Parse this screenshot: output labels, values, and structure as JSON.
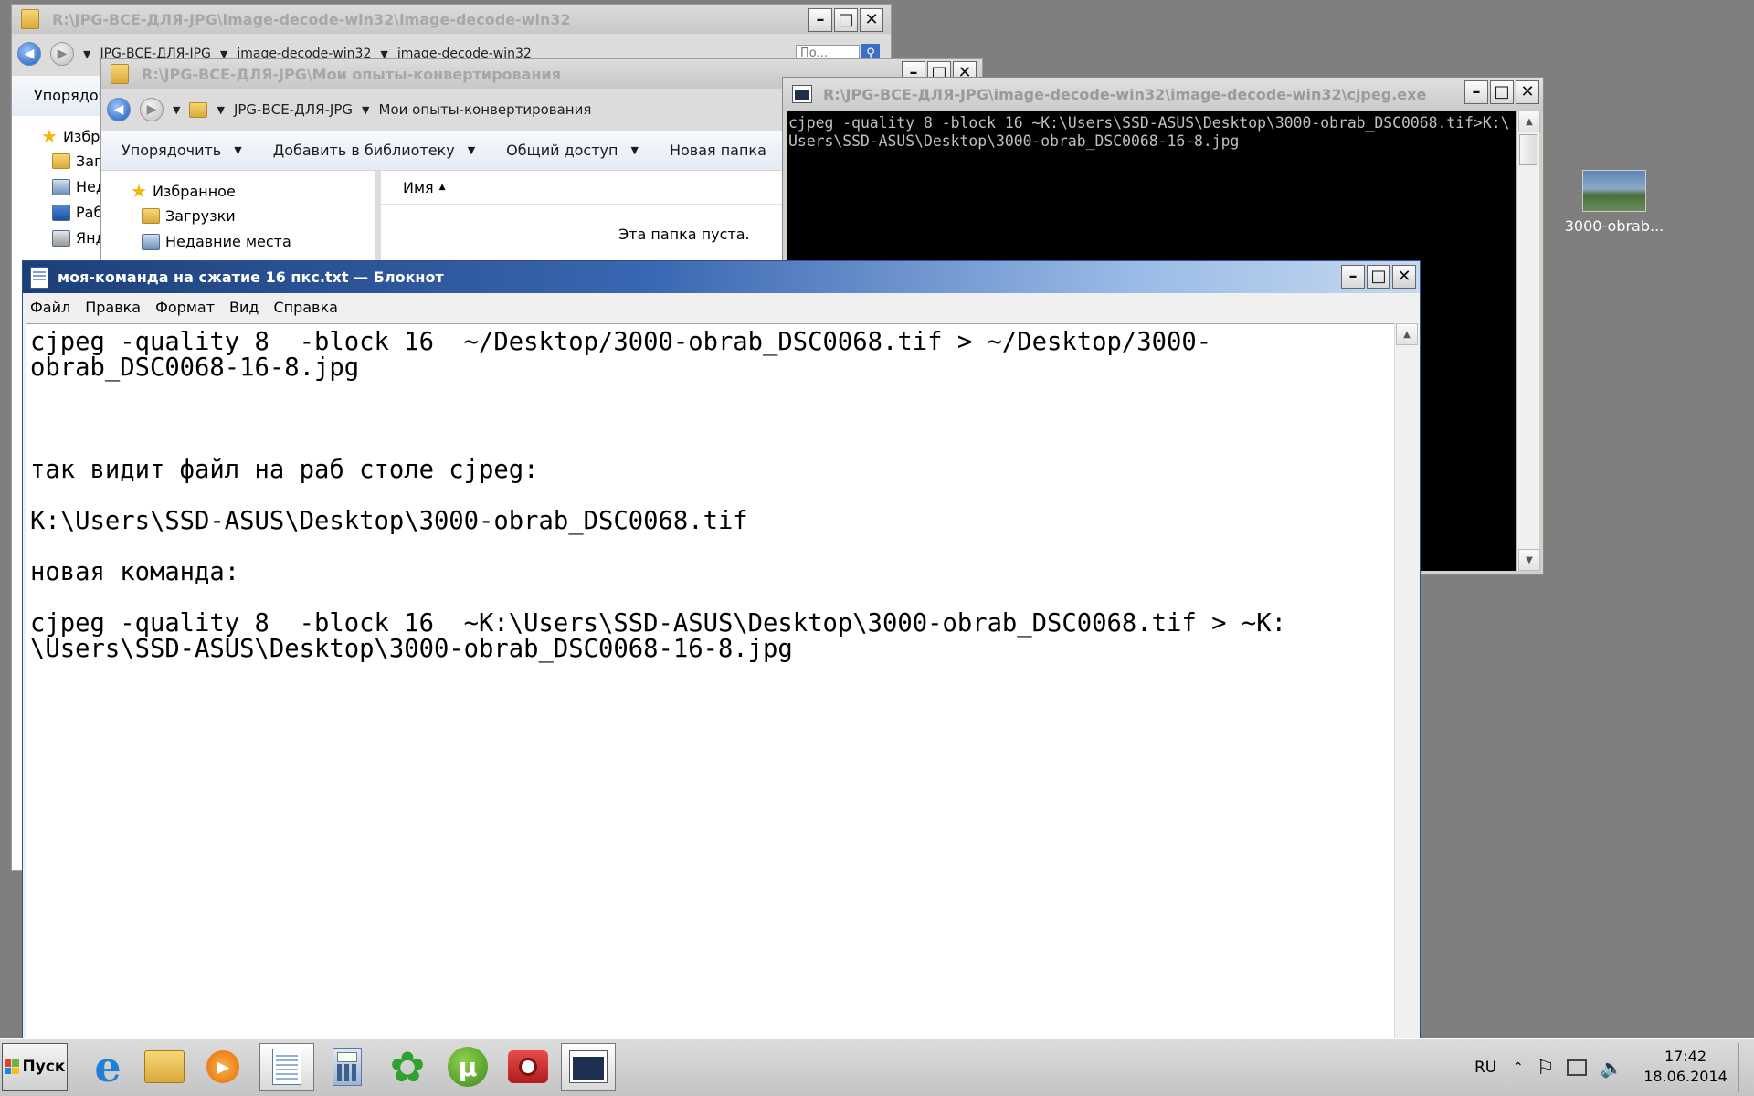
{
  "explorer_back": {
    "title": "R:\\JPG-ВСЕ-ДЛЯ-JPG\\image-decode-win32\\image-decode-win32",
    "breadcrumb": [
      "JPG-ВСЕ-ДЛЯ-JPG",
      "image-decode-win32",
      "image-decode-win32"
    ],
    "search_placeholder": "По...",
    "toolbar_first": "Упорядоч",
    "nav_items": [
      "Избр",
      "Заг",
      "Нед",
      "Раб",
      "Янд"
    ]
  },
  "explorer_front": {
    "title": "R:\\JPG-ВСЕ-ДЛЯ-JPG\\Мои опыты-конвертирования",
    "breadcrumb": [
      "JPG-ВСЕ-ДЛЯ-JPG",
      "Мои опыты-конвертирования"
    ],
    "toolbar": [
      "Упорядочить",
      "Добавить в библиотеку",
      "Общий доступ",
      "Новая папка"
    ],
    "nav_items": [
      "Избранное",
      "Загрузки",
      "Недавние места"
    ],
    "column_name": "Имя",
    "empty_text": "Эта папка пуста."
  },
  "console": {
    "title": "R:\\JPG-ВСЕ-ДЛЯ-JPG\\image-decode-win32\\image-decode-win32\\cjpeg.exe",
    "lines": [
      "cjpeg -quality 8 -block 16 ~K:\\Users\\SSD-ASUS\\Desktop\\3000-obrab_DSC0068.tif>K:\\",
      "Users\\SSD-ASUS\\Desktop\\3000-obrab_DSC0068-16-8.jpg"
    ]
  },
  "notepad": {
    "title": "моя-команда на сжатие 16 пкс.txt — Блокнот",
    "menu": [
      "Файл",
      "Правка",
      "Формат",
      "Вид",
      "Справка"
    ],
    "lines": [
      "cjpeg -quality 8  -block 16  ~/Desktop/3000-obrab_DSC0068.tif > ~/Desktop/3000-",
      "obrab_DSC0068-16-8.jpg",
      "",
      "",
      "",
      "так видит файл на раб столе cjpeg:",
      "",
      "K:\\Users\\SSD-ASUS\\Desktop\\3000-obrab_DSC0068.tif",
      "",
      "новая команда:",
      "",
      "cjpeg -quality 8  -block 16  ~K:\\Users\\SSD-ASUS\\Desktop\\3000-obrab_DSC0068.tif > ~K:",
      "\\Users\\SSD-ASUS\\Desktop\\3000-obrab_DSC0068-16-8.jpg"
    ]
  },
  "desktop_icon": {
    "label": "3000-obrab..."
  },
  "taskbar": {
    "start_label": "Пуск",
    "apps": [
      "internet-explorer-icon",
      "explorer-icon",
      "media-player-icon",
      "notepad-icon",
      "calculator-icon",
      "icq-icon",
      "utorrent-icon",
      "camera-app-icon",
      "console-icon"
    ],
    "language": "RU",
    "time": "17:42",
    "date": "18.06.2014"
  },
  "colors": {
    "desktop": "#7f7f7f",
    "notepad_title_start": "#1c3f79",
    "console_bg": "#000000"
  }
}
